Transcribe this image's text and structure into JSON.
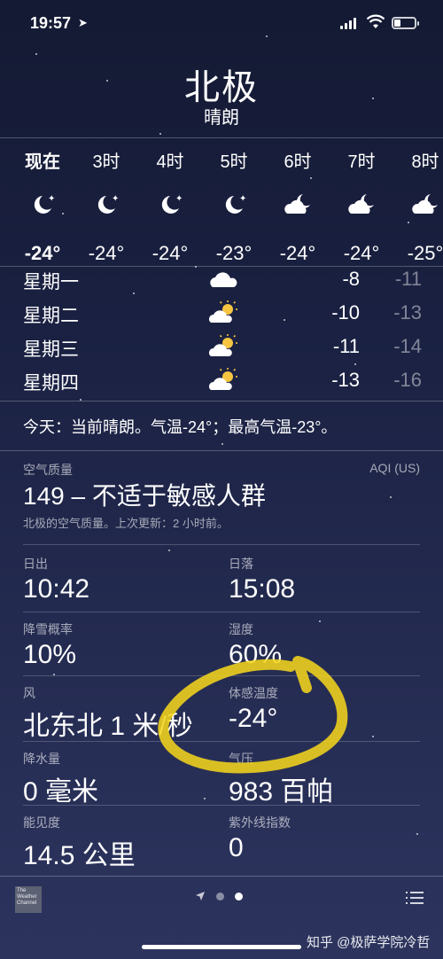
{
  "status_bar": {
    "time": "19:57"
  },
  "header": {
    "city": "北极",
    "condition": "晴朗"
  },
  "hourly": [
    {
      "label": "现在",
      "icon": "moon-star-icon",
      "temp": "-24°"
    },
    {
      "label": "3时",
      "icon": "moon-star-icon",
      "temp": "-24°"
    },
    {
      "label": "4时",
      "icon": "moon-star-icon",
      "temp": "-24°"
    },
    {
      "label": "5时",
      "icon": "moon-star-icon",
      "temp": "-23°"
    },
    {
      "label": "6时",
      "icon": "cloud-moon-icon",
      "temp": "-24°"
    },
    {
      "label": "7时",
      "icon": "cloud-moon-icon",
      "temp": "-24°"
    },
    {
      "label": "8时",
      "icon": "cloud-moon-icon",
      "temp": "-25°"
    }
  ],
  "daily": [
    {
      "day": "星期一",
      "icon": "cloud-icon",
      "high": "-8",
      "low": "-11"
    },
    {
      "day": "星期二",
      "icon": "partly-sunny-icon",
      "high": "-10",
      "low": "-13"
    },
    {
      "day": "星期三",
      "icon": "partly-sunny-icon",
      "high": "-11",
      "low": "-14"
    },
    {
      "day": "星期四",
      "icon": "partly-sunny-icon",
      "high": "-13",
      "low": "-16"
    }
  ],
  "summary": "今天：当前晴朗。气温-24°；最高气温-23°。",
  "aqi": {
    "label": "空气质量",
    "unit": "AQI (US)",
    "value": "149 – 不适于敏感人群",
    "note": "北极的空气质量。上次更新：2 小时前。"
  },
  "details": {
    "sunrise": {
      "label": "日出",
      "value": "10:42"
    },
    "sunset": {
      "label": "日落",
      "value": "15:08"
    },
    "snow_chance": {
      "label": "降雪概率",
      "value": "10%"
    },
    "humidity": {
      "label": "湿度",
      "value": "60%"
    },
    "wind": {
      "label": "风",
      "value": "北东北 1 米/秒"
    },
    "feels_like": {
      "label": "体感温度",
      "value": "-24°"
    },
    "precipitation": {
      "label": "降水量",
      "value": "0 毫米"
    },
    "pressure": {
      "label": "气压",
      "value": "983 百帕"
    },
    "visibility": {
      "label": "能见度",
      "value": "14.5 公里"
    },
    "uv_index": {
      "label": "紫外线指数",
      "value": "0"
    }
  },
  "footer": {
    "brand_logo_text": "The Weather Channel",
    "page_count": 2,
    "active_page": 2,
    "watermark": "知乎 @极萨学院冷哲"
  },
  "colors": {
    "background_top": "#141a33",
    "background_bottom": "#2c345e",
    "annotation": "#f2d41c",
    "sun": "#f5c542"
  }
}
